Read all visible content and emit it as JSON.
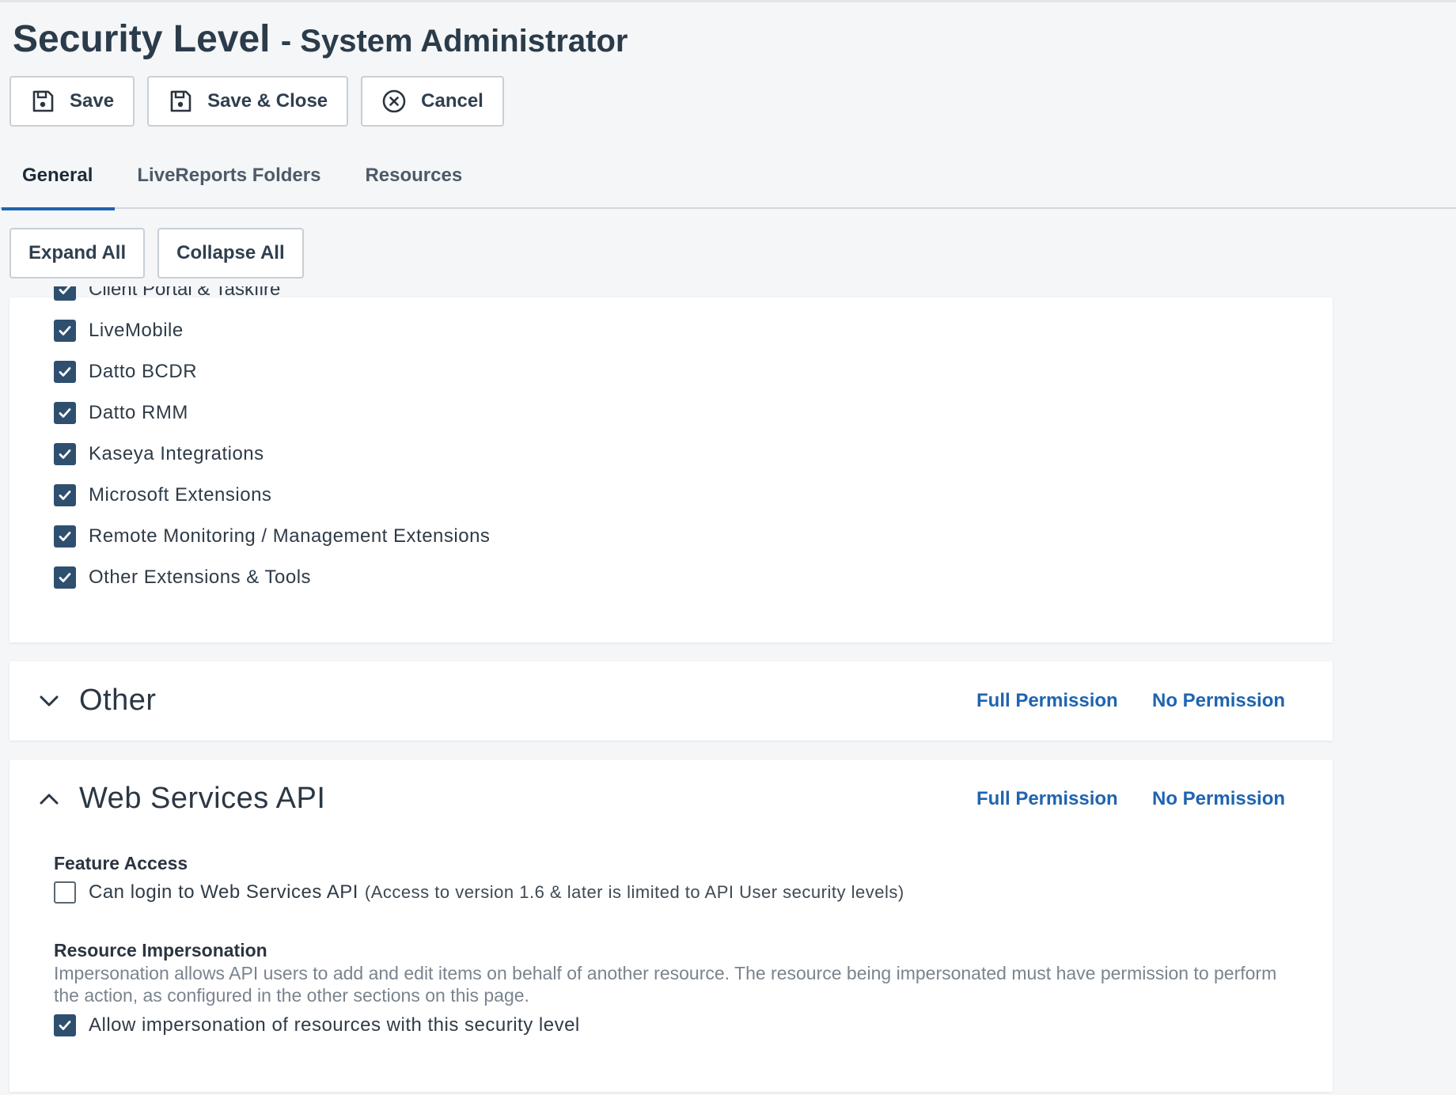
{
  "header": {
    "title": "Security Level",
    "subtitle": "- System Administrator"
  },
  "toolbar": {
    "save_label": "Save",
    "save_close_label": "Save & Close",
    "cancel_label": "Cancel"
  },
  "tabs": [
    {
      "label": "General",
      "active": true
    },
    {
      "label": "LiveReports Folders",
      "active": false
    },
    {
      "label": "Resources",
      "active": false
    }
  ],
  "section_controls": {
    "expand_all_label": "Expand All",
    "collapse_all_label": "Collapse All"
  },
  "integrations": {
    "partial_item": "Client Portal & Taskfire",
    "items": [
      {
        "label": "LiveMobile",
        "checked": true
      },
      {
        "label": "Datto BCDR",
        "checked": true
      },
      {
        "label": "Datto RMM",
        "checked": true
      },
      {
        "label": "Kaseya Integrations",
        "checked": true
      },
      {
        "label": "Microsoft Extensions",
        "checked": true
      },
      {
        "label": "Remote Monitoring / Management Extensions",
        "checked": true
      },
      {
        "label": "Other Extensions & Tools",
        "checked": true
      }
    ]
  },
  "other_section": {
    "title": "Other",
    "full_permission": "Full Permission",
    "no_permission": "No Permission"
  },
  "api_section": {
    "title": "Web Services API",
    "full_permission": "Full Permission",
    "no_permission": "No Permission",
    "feature_access_heading": "Feature Access",
    "login_label": "Can login to Web Services API",
    "login_note": "(Access to version 1.6 & later is limited to API User security levels)",
    "login_checked": false,
    "impersonation_heading": "Resource Impersonation",
    "impersonation_desc": "Impersonation allows API users to add and edit items on behalf of another resource. The resource being impersonated must have permission to perform the action, as configured in the other sections on this page.",
    "impersonation_label": "Allow impersonation of resources with this security level",
    "impersonation_checked": true
  },
  "colors": {
    "accent": "#1f64b0",
    "checkbox": "#2f4f6e",
    "background": "#f4f6f8"
  }
}
